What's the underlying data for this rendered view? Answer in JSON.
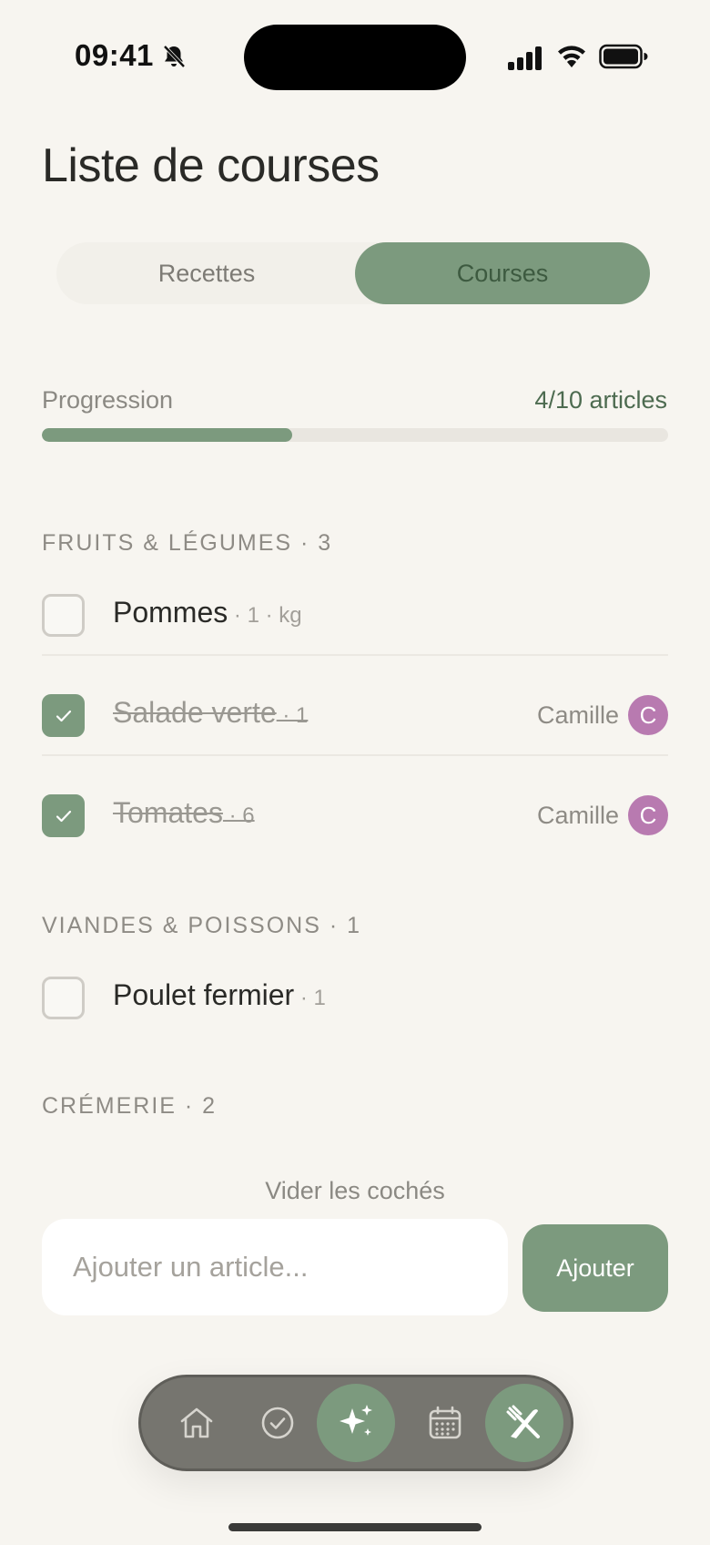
{
  "status_bar": {
    "time": "09:41",
    "icons": [
      "bell-slash-icon",
      "cellular-signal-icon",
      "wifi-icon",
      "battery-icon"
    ]
  },
  "header": {
    "title": "Liste de courses"
  },
  "segments": [
    {
      "label": "Recettes",
      "selected": false
    },
    {
      "label": "Courses",
      "selected": true
    }
  ],
  "progress": {
    "label": "Progression",
    "count_text": "4/10 articles",
    "done": 4,
    "total": 10
  },
  "categories": [
    {
      "title": "FRUITS & LÉGUMES · 3",
      "items": [
        {
          "name": "Pommes",
          "meta": " · 1 · kg",
          "checked": false,
          "by": "",
          "avatar": ""
        },
        {
          "name": "Salade verte",
          "meta": " · 1",
          "checked": true,
          "by": "Camille",
          "avatar": "C"
        },
        {
          "name": "Tomates",
          "meta": " · 6",
          "checked": true,
          "by": "Camille",
          "avatar": "C"
        }
      ]
    },
    {
      "title": "VIANDES & POISSONS · 1",
      "items": [
        {
          "name": "Poulet fermier",
          "meta": " · 1",
          "checked": false,
          "by": "",
          "avatar": ""
        }
      ]
    },
    {
      "title": "CRÉMERIE · 2",
      "items": []
    }
  ],
  "actions": {
    "clear_checked": "Vider les cochés",
    "add_placeholder": "Ajouter un article...",
    "add_button": "Ajouter"
  },
  "tabbar": {
    "tabs": [
      "home-icon",
      "check-circle-icon",
      "sparkles-icon",
      "calendar-icon",
      "fork-knife-icon"
    ]
  },
  "colors": {
    "accent": "#7c9a7e",
    "background": "#f7f5f0",
    "avatar": "#b87ab0",
    "tabbar": "#76756f"
  }
}
